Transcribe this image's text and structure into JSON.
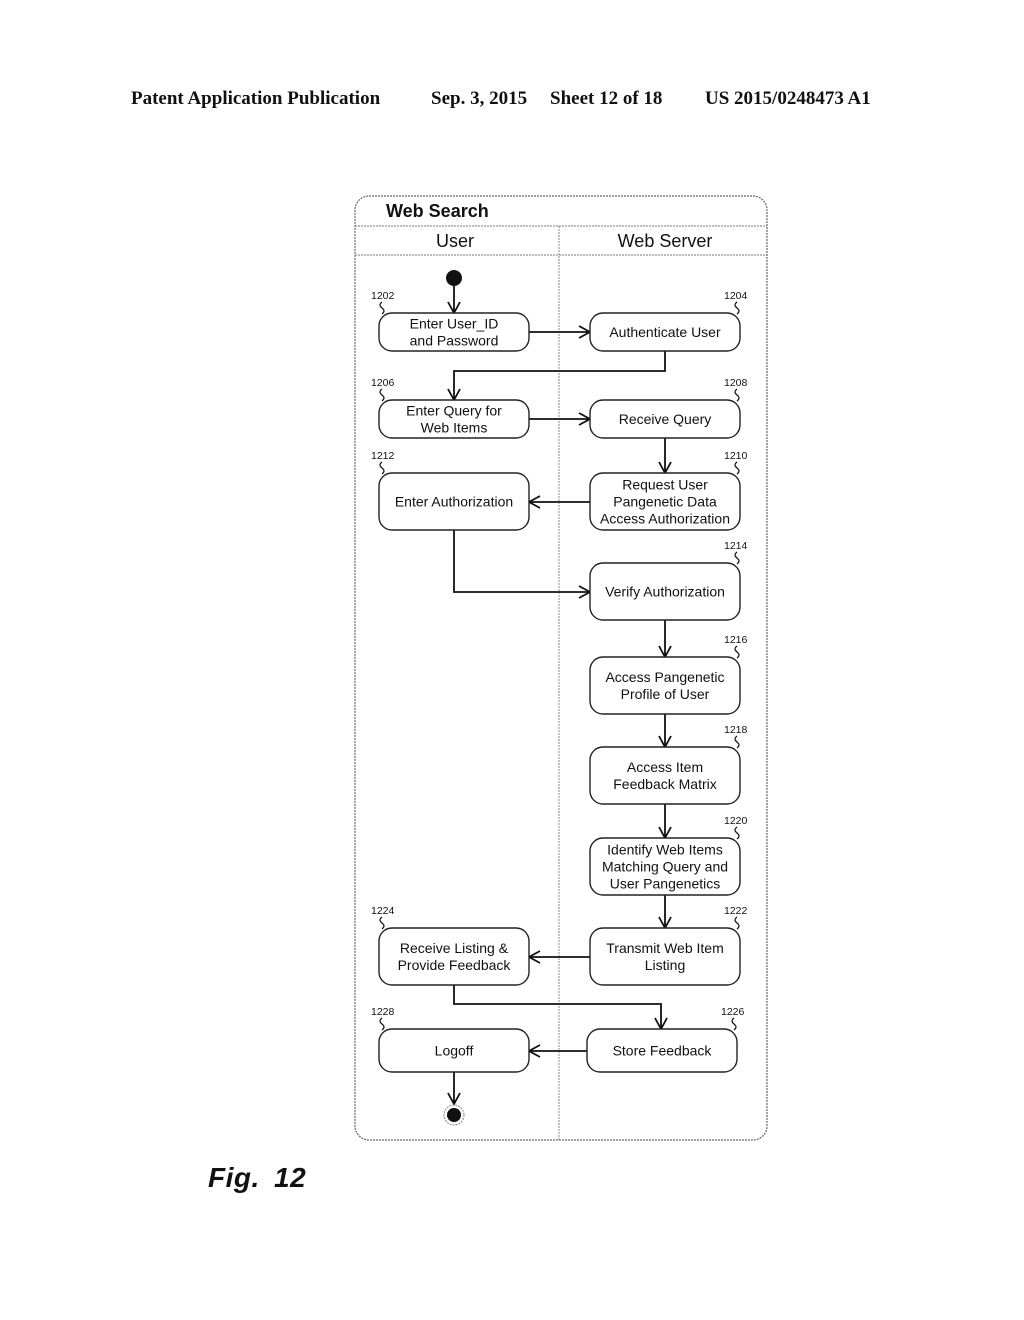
{
  "header": {
    "publication": "Patent Application Publication",
    "date": "Sep. 3, 2015",
    "sheet": "Sheet 12 of 18",
    "number": "US 2015/0248473 A1"
  },
  "diagram": {
    "title": "Web Search",
    "lanes": [
      {
        "id": "user",
        "label": "User"
      },
      {
        "id": "server",
        "label": "Web Server"
      }
    ],
    "nodes": [
      {
        "id": "1202",
        "ref": "1202",
        "lane": "user",
        "lines": [
          "Enter User_ID",
          "and Password"
        ]
      },
      {
        "id": "1204",
        "ref": "1204",
        "lane": "server",
        "lines": [
          "Authenticate User"
        ]
      },
      {
        "id": "1206",
        "ref": "1206",
        "lane": "user",
        "lines": [
          "Enter Query for",
          "Web Items"
        ]
      },
      {
        "id": "1208",
        "ref": "1208",
        "lane": "server",
        "lines": [
          "Receive Query"
        ]
      },
      {
        "id": "1210",
        "ref": "1210",
        "lane": "server",
        "lines": [
          "Request User",
          "Pangenetic Data",
          "Access Authorization"
        ]
      },
      {
        "id": "1212",
        "ref": "1212",
        "lane": "user",
        "lines": [
          "Enter Authorization"
        ]
      },
      {
        "id": "1214",
        "ref": "1214",
        "lane": "server",
        "lines": [
          "Verify Authorization"
        ]
      },
      {
        "id": "1216",
        "ref": "1216",
        "lane": "server",
        "lines": [
          "Access Pangenetic",
          "Profile of User"
        ]
      },
      {
        "id": "1218",
        "ref": "1218",
        "lane": "server",
        "lines": [
          "Access Item",
          "Feedback Matrix"
        ]
      },
      {
        "id": "1220",
        "ref": "1220",
        "lane": "server",
        "lines": [
          "Identify Web Items",
          "Matching Query and",
          "User Pangenetics"
        ]
      },
      {
        "id": "1222",
        "ref": "1222",
        "lane": "server",
        "lines": [
          "Transmit Web Item",
          "Listing"
        ]
      },
      {
        "id": "1224",
        "ref": "1224",
        "lane": "user",
        "lines": [
          "Receive Listing &",
          "Provide Feedback"
        ]
      },
      {
        "id": "1226",
        "ref": "1226",
        "lane": "server",
        "lines": [
          "Store Feedback"
        ]
      },
      {
        "id": "1228",
        "ref": "1228",
        "lane": "user",
        "lines": [
          "Logoff"
        ]
      }
    ],
    "edges": [
      {
        "from": "start",
        "to": "1202"
      },
      {
        "from": "1202",
        "to": "1204"
      },
      {
        "from": "1204",
        "to": "1206"
      },
      {
        "from": "1206",
        "to": "1208"
      },
      {
        "from": "1208",
        "to": "1210"
      },
      {
        "from": "1210",
        "to": "1212"
      },
      {
        "from": "1212",
        "to": "1214"
      },
      {
        "from": "1214",
        "to": "1216"
      },
      {
        "from": "1216",
        "to": "1218"
      },
      {
        "from": "1218",
        "to": "1220"
      },
      {
        "from": "1220",
        "to": "1222"
      },
      {
        "from": "1222",
        "to": "1224"
      },
      {
        "from": "1224",
        "to": "1226"
      },
      {
        "from": "1226",
        "to": "1228"
      },
      {
        "from": "1228",
        "to": "end"
      }
    ]
  },
  "figure_label": "Fig. 12"
}
